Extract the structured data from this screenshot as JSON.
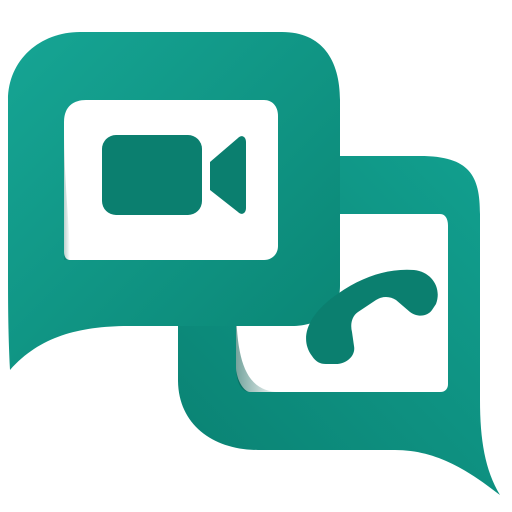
{
  "colors": {
    "background": "#ffffff",
    "teal_light": "#16a594",
    "teal_mid": "#0d9384",
    "teal_dark": "#077565",
    "glyph": "#0b7f6f",
    "screen": "#ffffff"
  },
  "icons": {
    "logo": "video-call-chat-logo-icon",
    "left_bubble": "chat-bubble-left-icon",
    "right_bubble": "chat-bubble-right-icon",
    "video": "video-camera-icon",
    "phone": "phone-handset-icon"
  }
}
